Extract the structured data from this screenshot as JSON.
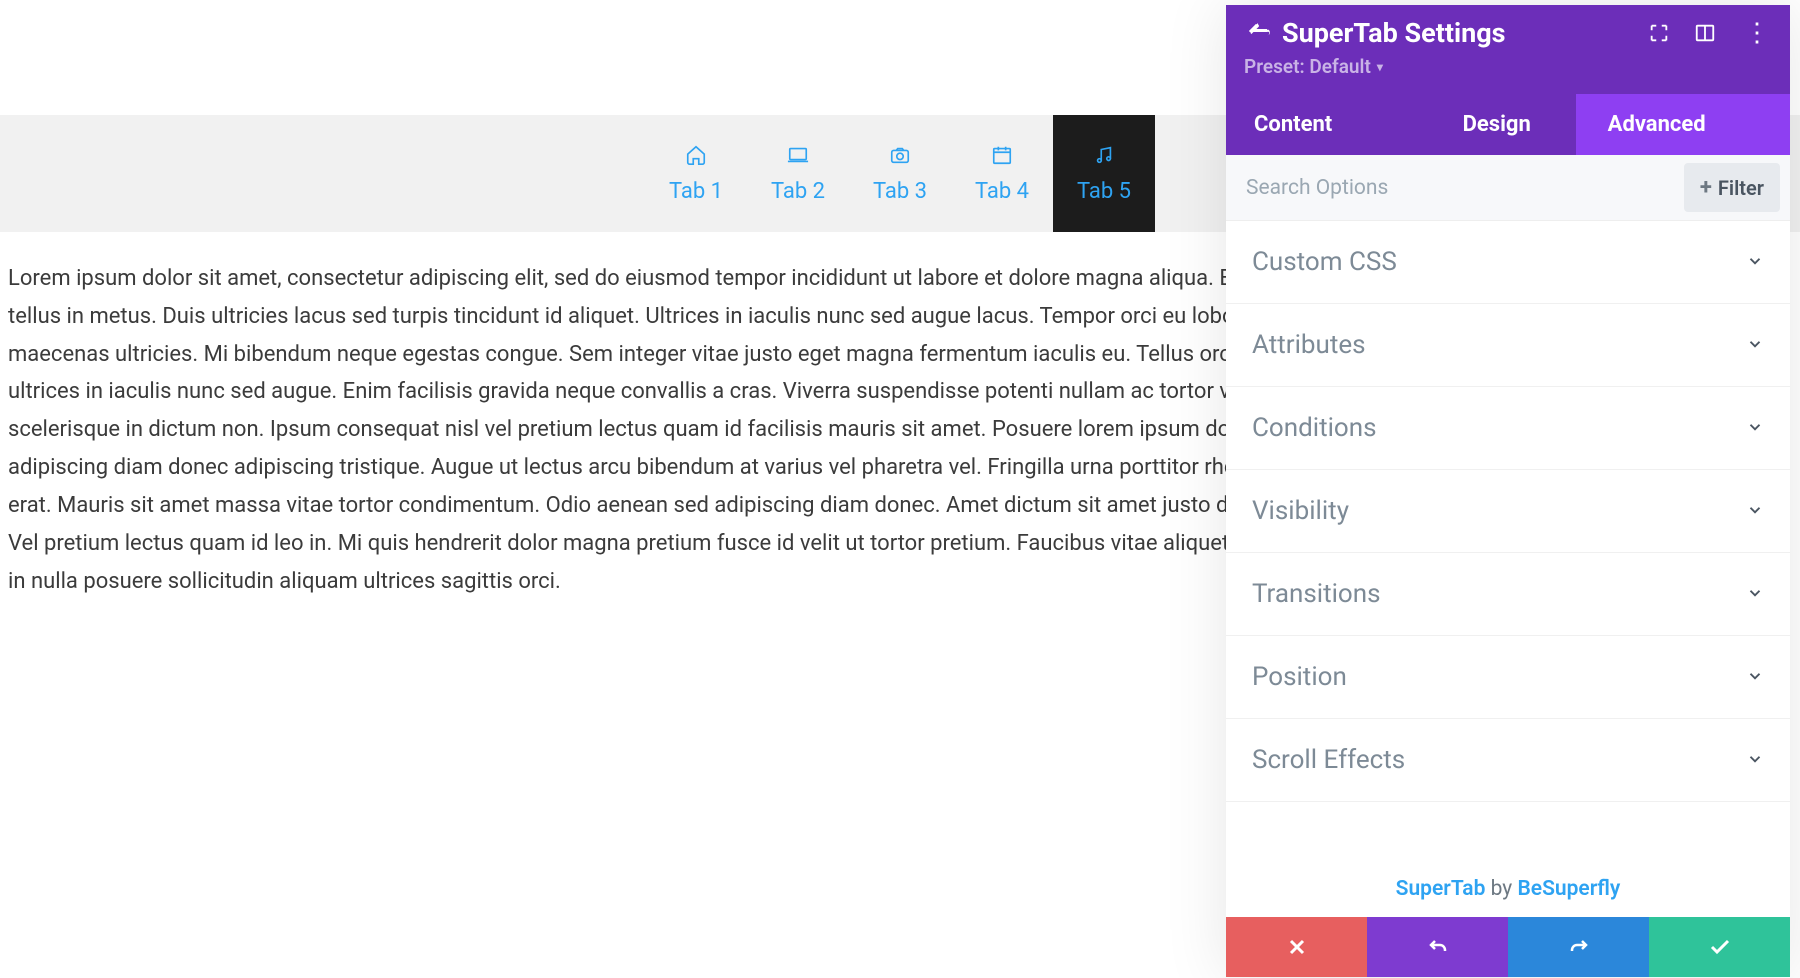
{
  "page": {
    "tabs": [
      {
        "label": "Tab 1",
        "icon": "home-icon",
        "active": false
      },
      {
        "label": "Tab 2",
        "icon": "laptop-icon",
        "active": false
      },
      {
        "label": "Tab 3",
        "icon": "camera-icon",
        "active": false
      },
      {
        "label": "Tab 4",
        "icon": "calendar-icon",
        "active": false
      },
      {
        "label": "Tab 5",
        "icon": "music-icon",
        "active": true
      }
    ],
    "body": "Lorem ipsum dolor sit amet, consectetur adipiscing elit, sed do eiusmod tempor incididunt ut labore et dolore magna aliqua. Et malesuada fames ac turpis. Volutpat diam ut venenatis tellus in metus. Duis ultricies lacus sed turpis tincidunt id aliquet. Ultrices in iaculis nunc sed augue lacus. Tempor orci eu lobortis elementum. Ut pharetra sit amet aliquam id diam maecenas ultricies. Mi bibendum neque egestas congue. Sem integer vitae justo eget magna fermentum iaculis eu. Tellus orci ac auctor augue mauris augue. Tempor orci dapibus ultrices in iaculis nunc sed augue. Enim facilisis gravida neque convallis a cras. Viverra suspendisse potenti nullam ac tortor vitae purus. Volutpat blandit aliquam etiam erat velit scelerisque in dictum non. Ipsum consequat nisl vel pretium lectus quam id facilisis mauris sit amet. Posuere lorem ipsum dolor sit amet consectetur adipiscing elit. Aenean sed adipiscing diam donec adipiscing tristique. Augue ut lectus arcu bibendum at varius vel pharetra vel. Fringilla urna porttitor rhoncus dolor purus non enim. Dictum non consectetur a erat. Mauris sit amet massa vitae tortor condimentum. Odio aenean sed adipiscing diam donec. Amet dictum sit amet justo donec enim. Posuere ac ut consequat semper viverra nam. Vel pretium lectus quam id leo in. Mi quis hendrerit dolor magna pretium fusce id velit ut tortor pretium. Faucibus vitae aliquet nec ullamcorper sit amet risus nullam eget. Eleifend mi in nulla posuere sollicitudin aliquam ultrices sagittis orci."
  },
  "panel": {
    "title": "SuperTab Settings",
    "preset_label": "Preset: Default",
    "tabs": {
      "content": "Content",
      "design": "Design",
      "advanced": "Advanced",
      "active": "advanced"
    },
    "search_placeholder": "Search Options",
    "filter_label": "Filter",
    "options": [
      "Custom CSS",
      "Attributes",
      "Conditions",
      "Visibility",
      "Transitions",
      "Position",
      "Scroll Effects"
    ],
    "attribution": {
      "product": "SuperTab",
      "by": " by ",
      "author": "BeSuperfly"
    }
  }
}
